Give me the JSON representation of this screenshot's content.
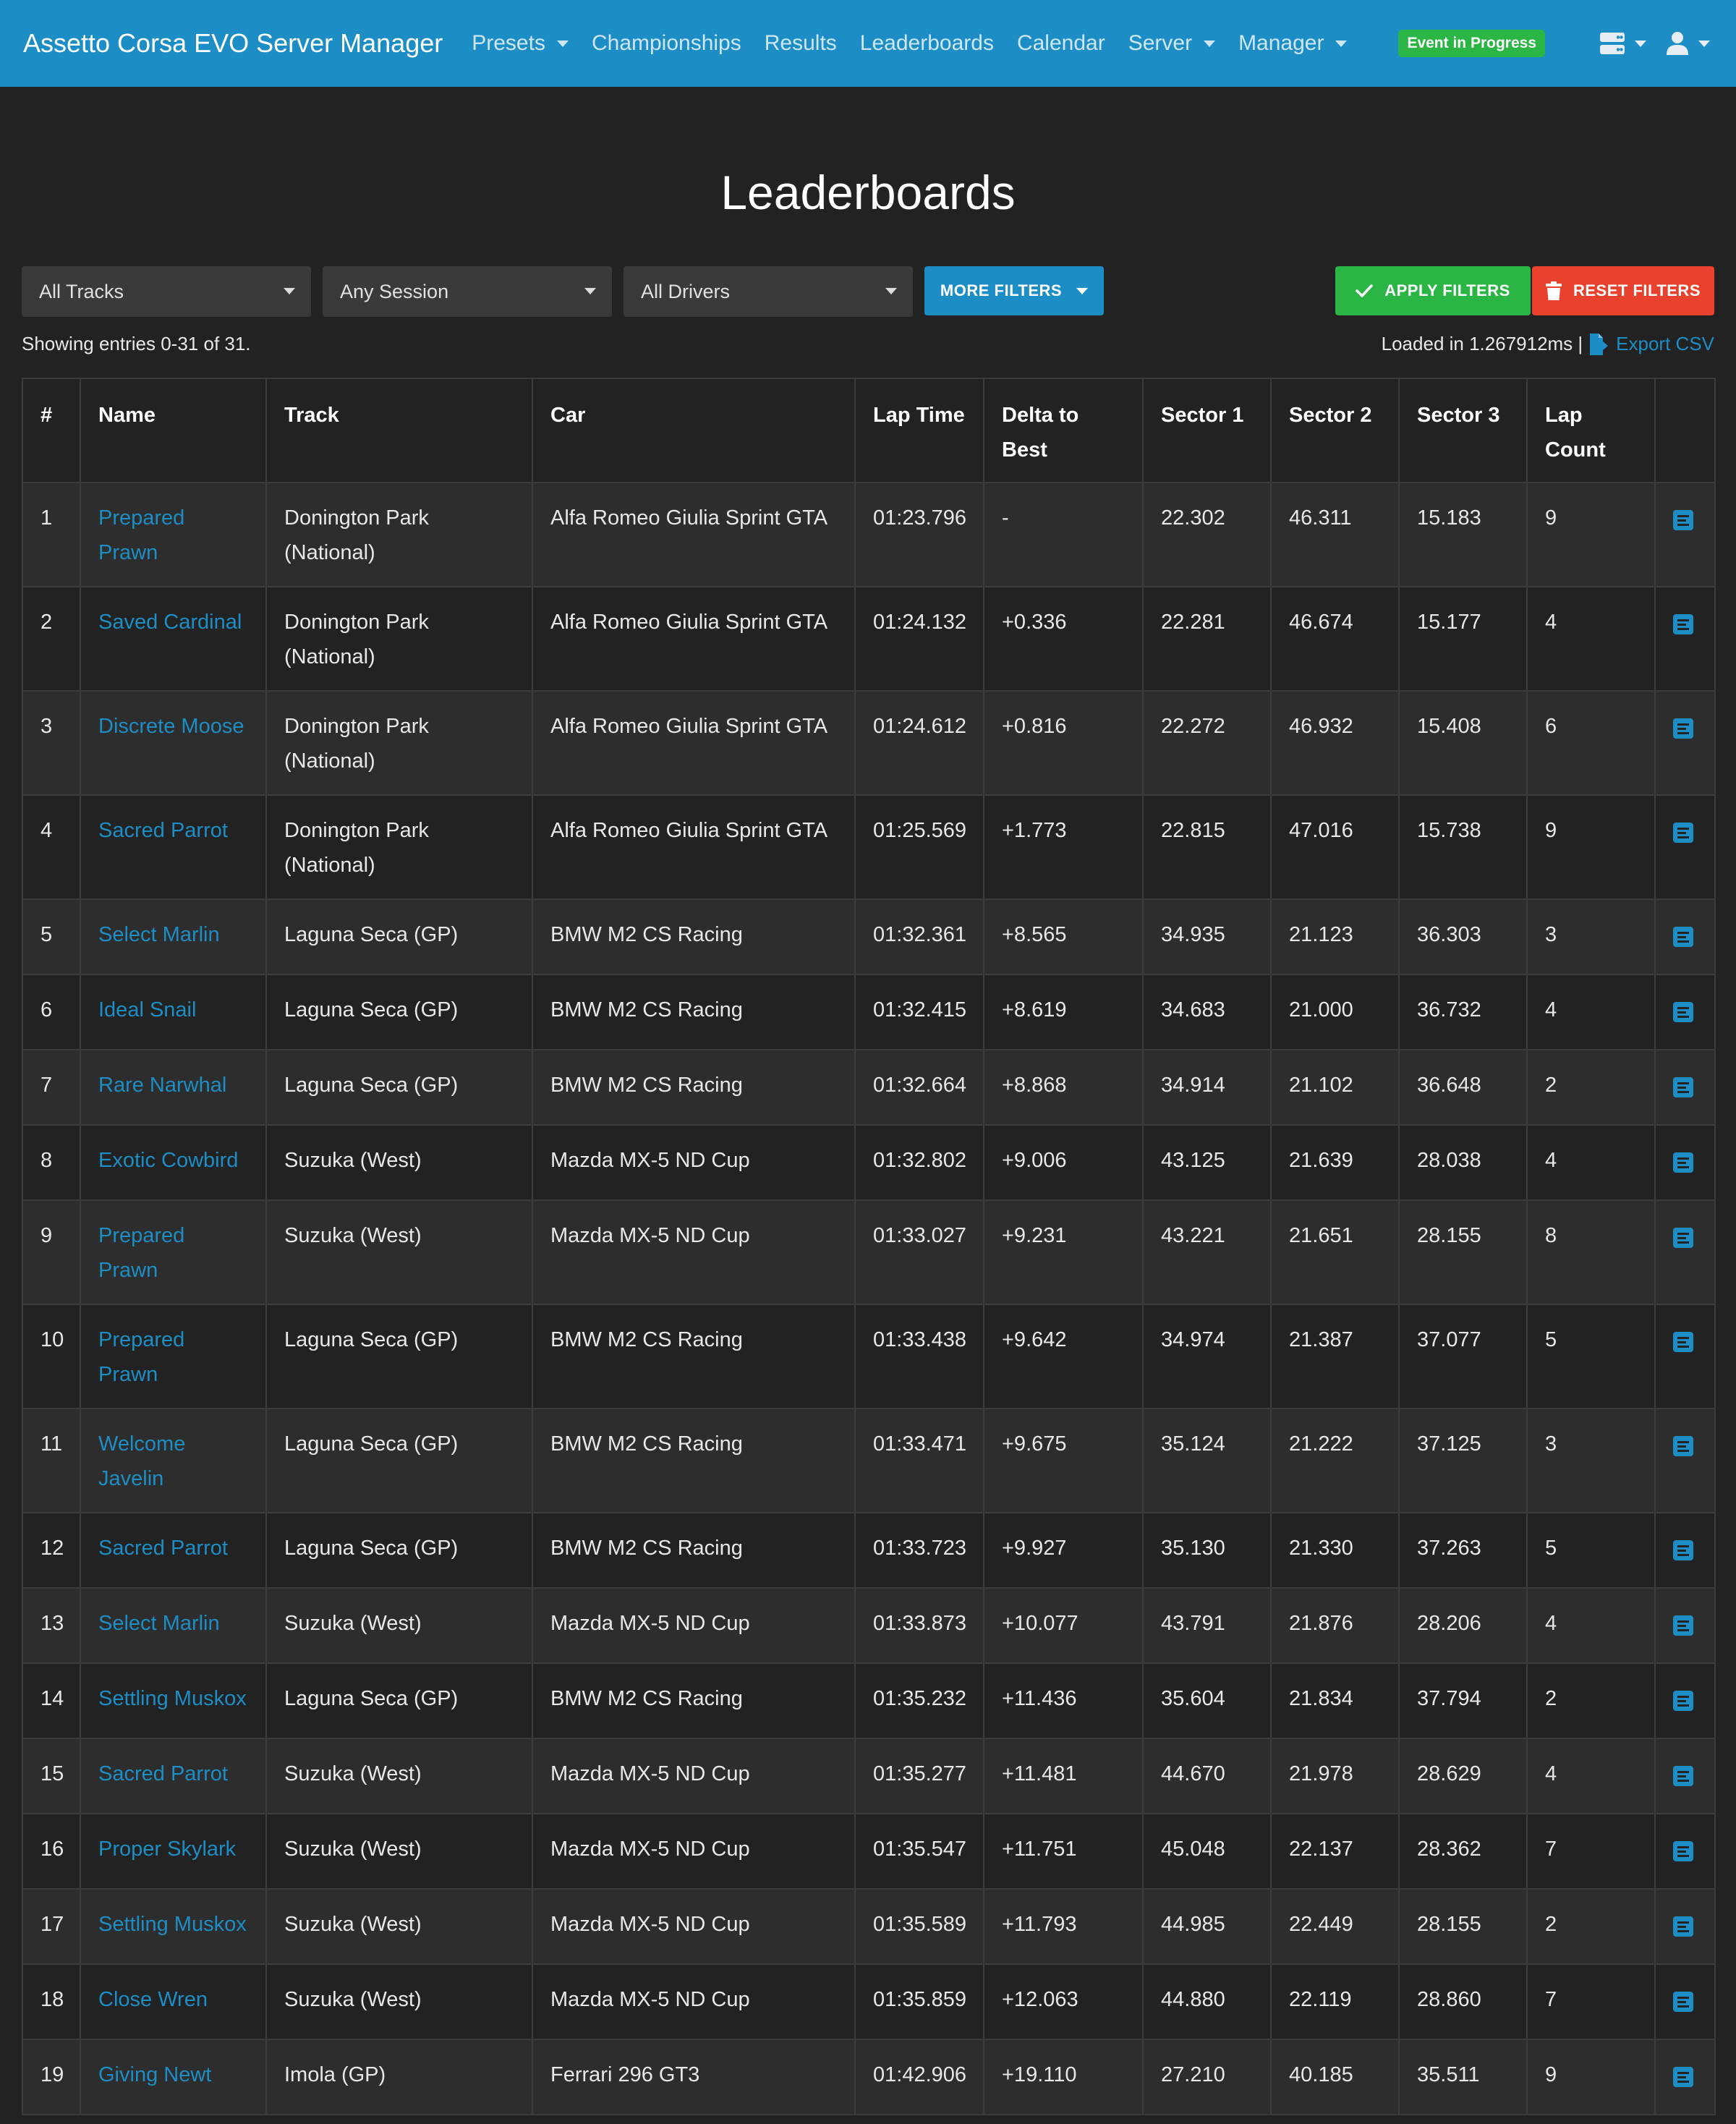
{
  "nav": {
    "brand": "Assetto Corsa EVO Server Manager",
    "links": [
      "Presets",
      "Championships",
      "Results",
      "Leaderboards",
      "Calendar",
      "Server",
      "Manager"
    ],
    "event_badge": "Event in Progress"
  },
  "page_title": "Leaderboards",
  "filters": {
    "track": "All Tracks",
    "session": "Any Session",
    "driver": "All Drivers",
    "more_label": "MORE FILTERS",
    "apply_label": "APPLY FILTERS",
    "reset_label": "RESET FILTERS"
  },
  "meta": {
    "showing": "Showing entries 0-31 of 31.",
    "loaded": "Loaded in 1.267912ms |",
    "export_label": "Export CSV"
  },
  "table": {
    "headers": [
      "#",
      "Name",
      "Track",
      "Car",
      "Lap Time",
      "Delta to Best",
      "Sector 1",
      "Sector 2",
      "Sector 3",
      "Lap Count"
    ],
    "rows": [
      [
        "1",
        "Prepared Prawn",
        "Donington Park (National)",
        "Alfa Romeo Giulia Sprint GTA",
        "01:23.796",
        "-",
        "22.302",
        "46.311",
        "15.183",
        "9"
      ],
      [
        "2",
        "Saved Cardinal",
        "Donington Park (National)",
        "Alfa Romeo Giulia Sprint GTA",
        "01:24.132",
        "+0.336",
        "22.281",
        "46.674",
        "15.177",
        "4"
      ],
      [
        "3",
        "Discrete Moose",
        "Donington Park (National)",
        "Alfa Romeo Giulia Sprint GTA",
        "01:24.612",
        "+0.816",
        "22.272",
        "46.932",
        "15.408",
        "6"
      ],
      [
        "4",
        "Sacred Parrot",
        "Donington Park (National)",
        "Alfa Romeo Giulia Sprint GTA",
        "01:25.569",
        "+1.773",
        "22.815",
        "47.016",
        "15.738",
        "9"
      ],
      [
        "5",
        "Select Marlin",
        "Laguna Seca (GP)",
        "BMW M2 CS Racing",
        "01:32.361",
        "+8.565",
        "34.935",
        "21.123",
        "36.303",
        "3"
      ],
      [
        "6",
        "Ideal Snail",
        "Laguna Seca (GP)",
        "BMW M2 CS Racing",
        "01:32.415",
        "+8.619",
        "34.683",
        "21.000",
        "36.732",
        "4"
      ],
      [
        "7",
        "Rare Narwhal",
        "Laguna Seca (GP)",
        "BMW M2 CS Racing",
        "01:32.664",
        "+8.868",
        "34.914",
        "21.102",
        "36.648",
        "2"
      ],
      [
        "8",
        "Exotic Cowbird",
        "Suzuka (West)",
        "Mazda MX-5 ND Cup",
        "01:32.802",
        "+9.006",
        "43.125",
        "21.639",
        "28.038",
        "4"
      ],
      [
        "9",
        "Prepared Prawn",
        "Suzuka (West)",
        "Mazda MX-5 ND Cup",
        "01:33.027",
        "+9.231",
        "43.221",
        "21.651",
        "28.155",
        "8"
      ],
      [
        "10",
        "Prepared Prawn",
        "Laguna Seca (GP)",
        "BMW M2 CS Racing",
        "01:33.438",
        "+9.642",
        "34.974",
        "21.387",
        "37.077",
        "5"
      ],
      [
        "11",
        "Welcome Javelin",
        "Laguna Seca (GP)",
        "BMW M2 CS Racing",
        "01:33.471",
        "+9.675",
        "35.124",
        "21.222",
        "37.125",
        "3"
      ],
      [
        "12",
        "Sacred Parrot",
        "Laguna Seca (GP)",
        "BMW M2 CS Racing",
        "01:33.723",
        "+9.927",
        "35.130",
        "21.330",
        "37.263",
        "5"
      ],
      [
        "13",
        "Select Marlin",
        "Suzuka (West)",
        "Mazda MX-5 ND Cup",
        "01:33.873",
        "+10.077",
        "43.791",
        "21.876",
        "28.206",
        "4"
      ],
      [
        "14",
        "Settling Muskox",
        "Laguna Seca (GP)",
        "BMW M2 CS Racing",
        "01:35.232",
        "+11.436",
        "35.604",
        "21.834",
        "37.794",
        "2"
      ],
      [
        "15",
        "Sacred Parrot",
        "Suzuka (West)",
        "Mazda MX-5 ND Cup",
        "01:35.277",
        "+11.481",
        "44.670",
        "21.978",
        "28.629",
        "4"
      ],
      [
        "16",
        "Proper Skylark",
        "Suzuka (West)",
        "Mazda MX-5 ND Cup",
        "01:35.547",
        "+11.751",
        "45.048",
        "22.137",
        "28.362",
        "7"
      ],
      [
        "17",
        "Settling Muskox",
        "Suzuka (West)",
        "Mazda MX-5 ND Cup",
        "01:35.589",
        "+11.793",
        "44.985",
        "22.449",
        "28.155",
        "2"
      ],
      [
        "18",
        "Close Wren",
        "Suzuka (West)",
        "Mazda MX-5 ND Cup",
        "01:35.859",
        "+12.063",
        "44.880",
        "22.119",
        "28.860",
        "7"
      ],
      [
        "19",
        "Giving Newt",
        "Imola (GP)",
        "Ferrari 296 GT3",
        "01:42.906",
        "+19.110",
        "27.210",
        "40.185",
        "35.511",
        "9"
      ]
    ]
  },
  "colors": {
    "navbar": "#1d8ec5",
    "background": "#222222",
    "link": "#1d8ec5",
    "apply": "#2ab545",
    "reset": "#e8412e"
  }
}
